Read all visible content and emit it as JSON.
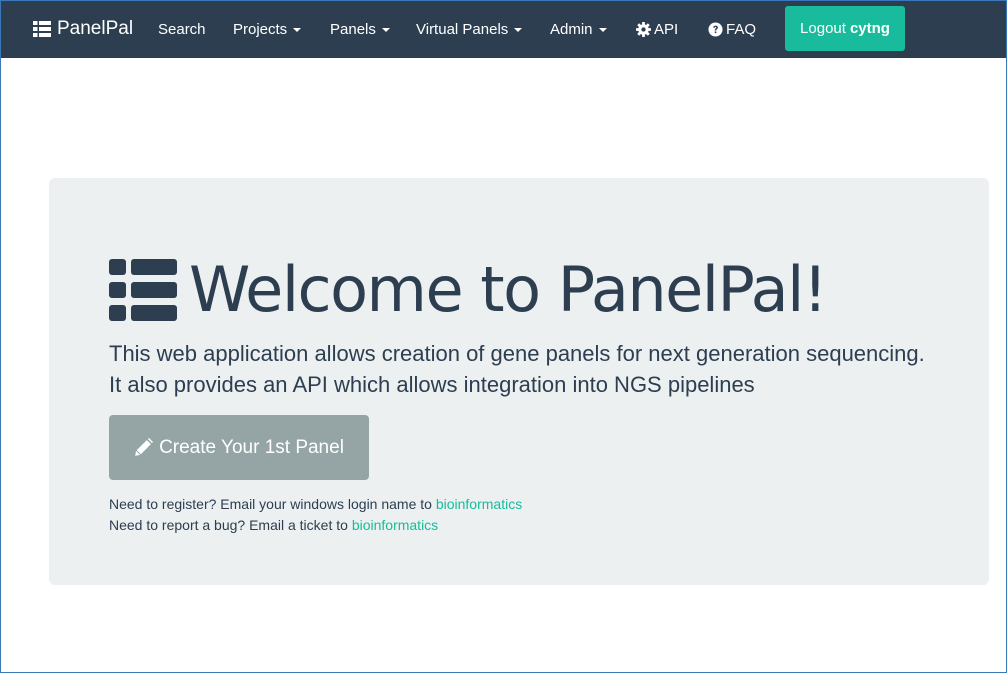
{
  "navbar": {
    "brand": "PanelPal",
    "brand_icon": "list-icon",
    "items": [
      {
        "label": "Search",
        "dropdown": false
      },
      {
        "label": "Projects",
        "dropdown": true
      },
      {
        "label": "Panels",
        "dropdown": true
      },
      {
        "label": "Virtual Panels",
        "dropdown": true
      },
      {
        "label": "Admin",
        "dropdown": true
      },
      {
        "label": "API",
        "icon": "gear-icon"
      },
      {
        "label": "FAQ",
        "icon": "question-circle-icon"
      }
    ],
    "logout": {
      "prefix": "Logout",
      "user": "cytng"
    }
  },
  "jumbotron": {
    "title": "Welcome to PanelPal!",
    "title_icon": "list-icon",
    "lead": "This web application allows creation of gene panels for next generation sequencing. It also provides an API which allows integration into NGS pipelines",
    "create_button": {
      "label": "Create Your 1st Panel",
      "icon": "pencil-icon"
    },
    "register_note": {
      "text": "Need to register? Email your windows login name to ",
      "link": "bioinformatics"
    },
    "bug_note": {
      "text": "Need to report a bug? Email a ticket to ",
      "link": "bioinformatics"
    }
  },
  "colors": {
    "navbar_bg": "#2c3e50",
    "accent": "#18bc9c",
    "jumbotron_bg": "#ecf0f1",
    "button_muted": "#95a5a6",
    "text_dark": "#2c3e50"
  }
}
